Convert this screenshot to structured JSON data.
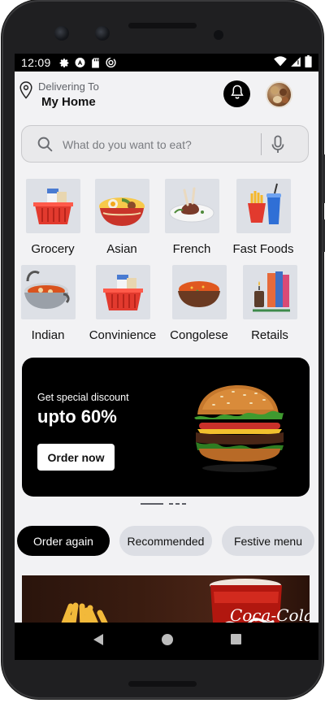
{
  "status_bar": {
    "time": "12:09"
  },
  "header": {
    "delivering_label": "Delivering To",
    "location": "My Home"
  },
  "search": {
    "placeholder": "What do you want to eat?"
  },
  "categories": [
    {
      "label": "Grocery"
    },
    {
      "label": "Asian"
    },
    {
      "label": "French"
    },
    {
      "label": "Fast Foods"
    },
    {
      "label": "Indian"
    },
    {
      "label": "Convinience"
    },
    {
      "label": "Congolese"
    },
    {
      "label": "Retails"
    }
  ],
  "promo": {
    "subtitle": "Get special discount",
    "headline": "upto 60%",
    "button_label": "Order now"
  },
  "carousel": {
    "pages": 4,
    "active_index": 0
  },
  "tabs": [
    {
      "label": "Order again",
      "selected": true
    },
    {
      "label": "Recommended",
      "selected": false
    },
    {
      "label": "Festive menu",
      "selected": false
    }
  ],
  "bottom_card": {
    "brand_text": "Coca-Cola"
  },
  "colors": {
    "accent": "#000000",
    "chip_inactive": "#dcdee4",
    "background": "#f2f2f4"
  },
  "icons": [
    "location-pin-icon",
    "bell-icon",
    "search-icon",
    "mic-icon",
    "back-icon",
    "home-icon",
    "recents-icon"
  ]
}
